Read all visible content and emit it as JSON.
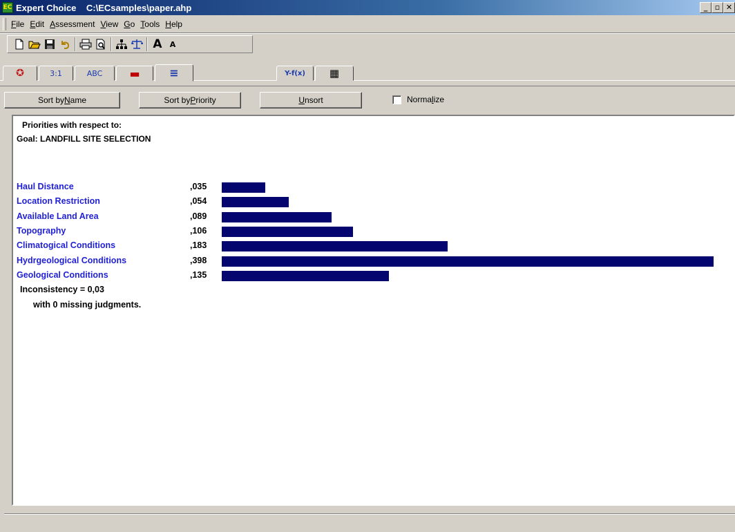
{
  "window": {
    "app_icon_text": "EC",
    "title": "Expert Choice    C:\\ECsamples\\paper.ahp",
    "min_label": "_",
    "max_label": "▫",
    "close_label": "✕"
  },
  "menu": {
    "items": [
      {
        "key": "F",
        "rest": "ile"
      },
      {
        "key": "E",
        "rest": "dit"
      },
      {
        "key": "A",
        "rest": "ssessment"
      },
      {
        "key": "V",
        "rest": "iew"
      },
      {
        "key": "G",
        "rest": "o"
      },
      {
        "key": "T",
        "rest": "ools"
      },
      {
        "key": "H",
        "rest": "elp"
      }
    ]
  },
  "toolbar": {
    "icons": [
      "new-file-icon",
      "open-folder-icon",
      "save-icon",
      "undo-icon",
      "print-icon",
      "print-preview-icon",
      "hierarchy-icon",
      "balance-icon",
      "font-larger-icon",
      "font-smaller-icon"
    ]
  },
  "tabs": {
    "t1": "✪",
    "t2": "3:1",
    "t3": "ABC",
    "t4": "▬",
    "t5": "≡",
    "t6": "Y-f(x)",
    "t7": "▦"
  },
  "sortbar": {
    "sort_name_pre": "Sort by ",
    "sort_name_key": "N",
    "sort_name_post": "ame",
    "sort_priority_pre": "Sort by ",
    "sort_priority_key": "P",
    "sort_priority_post": "riority",
    "unsort_key": "U",
    "unsort_post": "nsort",
    "normalize_pre": "Norma",
    "normalize_key": "l",
    "normalize_post": "ize",
    "normalize_checked": false
  },
  "report": {
    "heading1": "Priorities with respect to:",
    "heading2": "Goal: LANDFILL SITE SELECTION",
    "inconsistency": "Inconsistency = 0,03",
    "missing": "with 0  missing judgments.",
    "bar_color": "#050570",
    "name_color": "#1f1fd6"
  },
  "chart_data": {
    "type": "bar",
    "orientation": "horizontal",
    "categories": [
      "Haul Distance",
      "Location Restriction",
      "Available Land Area",
      "Topography",
      "Climatogical Conditions",
      "Hydrgeological Conditions",
      "Geological Conditions"
    ],
    "labels": [
      ",035",
      ",054",
      ",089",
      ",106",
      ",183",
      ",398",
      ",135"
    ],
    "values": [
      0.035,
      0.054,
      0.089,
      0.106,
      0.183,
      0.398,
      0.135
    ],
    "xlim": [
      0,
      0.398
    ]
  }
}
